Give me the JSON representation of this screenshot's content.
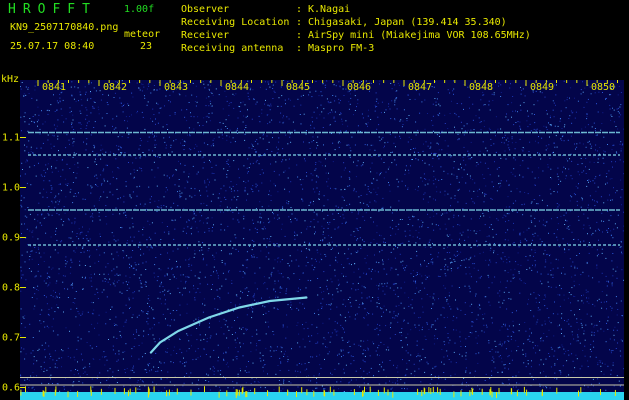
{
  "header": {
    "app_title": "HROFFT",
    "version": "1.00f",
    "file_name": "KN9_2507170840.png",
    "datetime": "25.07.17 08:40",
    "meteor_label": "meteor",
    "meteor_count": "23"
  },
  "meta": [
    {
      "key": "Observer",
      "sep": ":",
      "value": "K.Nagai"
    },
    {
      "key": "Receiving Location",
      "sep": ":",
      "value": "Chigasaki, Japan (139.414 35.340)"
    },
    {
      "key": "Receiver",
      "sep": ":",
      "value": "AirSpy mini (Miakejima VOR 108.65MHz)"
    },
    {
      "key": "Receiving antenna",
      "sep": ":",
      "value": "Maspro FM-3"
    }
  ],
  "chart_data": {
    "type": "heatmap",
    "ylabel": "kHz",
    "x_ticks": [
      "0841",
      "0842",
      "0843",
      "0844",
      "0845",
      "0846",
      "0847",
      "0848",
      "0849",
      "0850"
    ],
    "y_ticks": [
      "1.1",
      "1.0",
      "0.9",
      "0.8",
      "0.7",
      "0.6"
    ],
    "x_range_minutes": [
      0,
      10
    ],
    "y_range_khz": [
      0.575,
      1.215
    ],
    "carrier_lines_khz": [
      1.11,
      1.065,
      0.955,
      0.885
    ],
    "marker_lines_khz": [
      0.62,
      0.605
    ],
    "meteor_trace": {
      "points": [
        [
          1.85,
          0.67
        ],
        [
          2.0,
          0.69
        ],
        [
          2.3,
          0.713
        ],
        [
          2.8,
          0.74
        ],
        [
          3.3,
          0.76
        ],
        [
          3.8,
          0.773
        ],
        [
          4.4,
          0.78
        ]
      ]
    },
    "colors": {
      "background": "#03054a",
      "signal": "#7fd8e8",
      "tick_text": "#e8e800",
      "baseline": "#2ad4f0",
      "marker_line": "#c8c8a8"
    }
  }
}
